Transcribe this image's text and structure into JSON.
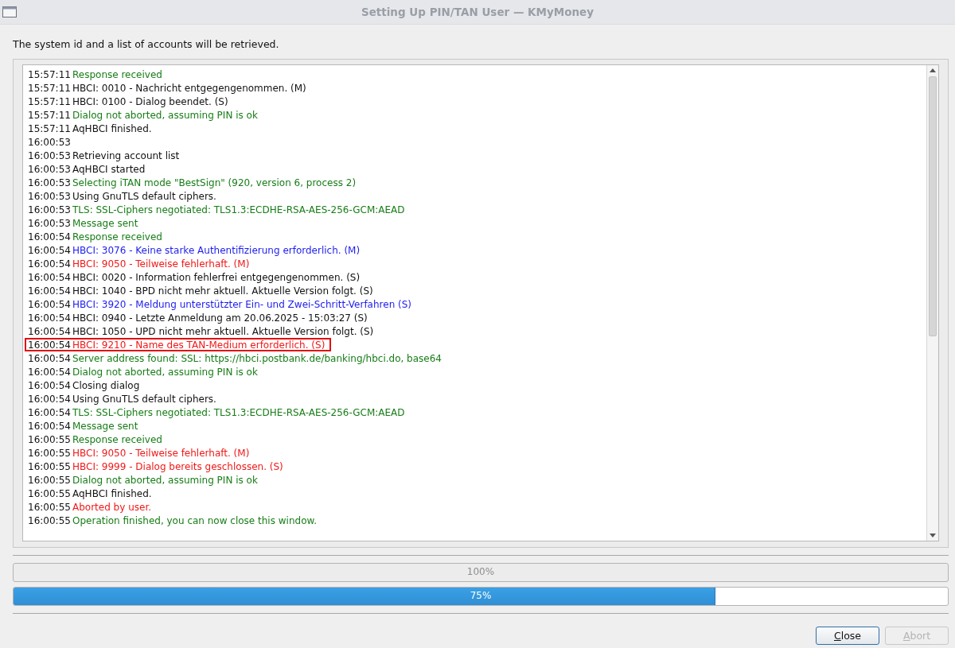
{
  "window": {
    "title": "Setting Up PIN/TAN User — KMyMoney"
  },
  "intro": "The system id and a list of accounts will be retrieved.",
  "log": [
    {
      "time": "15:57:11",
      "text": "Response received",
      "kind": "success",
      "highlighted": false
    },
    {
      "time": "15:57:11",
      "text": "HBCI: 0010 - Nachricht entgegengenommen. (M)",
      "kind": "normal",
      "highlighted": false
    },
    {
      "time": "15:57:11",
      "text": "HBCI: 0100 - Dialog beendet. (S)",
      "kind": "normal",
      "highlighted": false
    },
    {
      "time": "15:57:11",
      "text": "Dialog not aborted, assuming PIN is ok",
      "kind": "success",
      "highlighted": false
    },
    {
      "time": "15:57:11",
      "text": "AqHBCI finished.",
      "kind": "normal",
      "highlighted": false
    },
    {
      "time": "16:00:53",
      "highlighted": false
    },
    {
      "time": "16:00:53",
      "text": "Retrieving account list",
      "kind": "normal",
      "highlighted": false
    },
    {
      "time": "16:00:53",
      "text": "AqHBCI started",
      "kind": "normal",
      "highlighted": false
    },
    {
      "time": "16:00:53",
      "text": "Selecting iTAN mode \"BestSign\" (920, version 6, process 2)",
      "kind": "success",
      "highlighted": false
    },
    {
      "time": "16:00:53",
      "text": "Using GnuTLS default ciphers.",
      "kind": "normal",
      "highlighted": false
    },
    {
      "time": "16:00:53",
      "text": "TLS: SSL-Ciphers negotiated: TLS1.3:ECDHE-RSA-AES-256-GCM:AEAD",
      "kind": "success",
      "highlighted": false
    },
    {
      "time": "16:00:53",
      "text": "Message sent",
      "kind": "success",
      "highlighted": false
    },
    {
      "time": "16:00:54",
      "text": "Response received",
      "kind": "success",
      "highlighted": false
    },
    {
      "time": "16:00:54",
      "text": "HBCI: 3076 - Keine starke Authentifizierung erforderlich. (M)",
      "kind": "info",
      "highlighted": false
    },
    {
      "time": "16:00:54",
      "text": "HBCI: 9050 - Teilweise fehlerhaft. (M)",
      "kind": "error",
      "highlighted": false
    },
    {
      "time": "16:00:54",
      "text": "HBCI: 0020 - Information fehlerfrei entgegengenommen. (S)",
      "kind": "normal",
      "highlighted": false
    },
    {
      "time": "16:00:54",
      "text": "HBCI: 1040 - BPD nicht mehr aktuell. Aktuelle Version folgt. (S)",
      "kind": "normal",
      "highlighted": false
    },
    {
      "time": "16:00:54",
      "text": "HBCI: 3920 - Meldung unterstützter Ein- und Zwei-Schritt-Verfahren (S)",
      "kind": "info",
      "highlighted": false
    },
    {
      "time": "16:00:54",
      "text": "HBCI: 0940 - Letzte Anmeldung am 20.06.2025 - 15:03:27 (S)",
      "kind": "normal",
      "highlighted": false
    },
    {
      "time": "16:00:54",
      "text": "HBCI: 1050 - UPD nicht mehr aktuell. Aktuelle Version folgt. (S)",
      "kind": "normal",
      "highlighted": false
    },
    {
      "time": "16:00:54",
      "text": "HBCI: 9210 - Name des TAN-Medium erforderlich. (S)",
      "kind": "error",
      "highlighted": true
    },
    {
      "time": "16:00:54",
      "text": "Server address found: SSL: https://hbci.postbank.de/banking/hbci.do, base64",
      "kind": "success",
      "highlighted": false
    },
    {
      "time": "16:00:54",
      "text": "Dialog not aborted, assuming PIN is ok",
      "kind": "success",
      "highlighted": false
    },
    {
      "time": "16:00:54",
      "text": "Closing dialog",
      "kind": "normal",
      "highlighted": false
    },
    {
      "time": "16:00:54",
      "text": "Using GnuTLS default ciphers.",
      "kind": "normal",
      "highlighted": false
    },
    {
      "time": "16:00:54",
      "text": "TLS: SSL-Ciphers negotiated: TLS1.3:ECDHE-RSA-AES-256-GCM:AEAD",
      "kind": "success",
      "highlighted": false
    },
    {
      "time": "16:00:54",
      "text": "Message sent",
      "kind": "success",
      "highlighted": false
    },
    {
      "time": "16:00:55",
      "text": "Response received",
      "kind": "success",
      "highlighted": false
    },
    {
      "time": "16:00:55",
      "text": "HBCI: 9050 - Teilweise fehlerhaft. (M)",
      "kind": "error",
      "highlighted": false
    },
    {
      "time": "16:00:55",
      "text": "HBCI: 9999 - Dialog bereits geschlossen. (S)",
      "kind": "error",
      "highlighted": false
    },
    {
      "time": "16:00:55",
      "text": "Dialog not aborted, assuming PIN is ok",
      "kind": "success",
      "highlighted": false
    },
    {
      "time": "16:00:55",
      "text": "AqHBCI finished.",
      "kind": "normal",
      "highlighted": false
    },
    {
      "time": "16:00:55",
      "text": "Aborted by user.",
      "kind": "error",
      "highlighted": false
    },
    {
      "time": "16:00:55",
      "text": "Operation finished, you can now close this window.",
      "kind": "success",
      "highlighted": false
    }
  ],
  "progress": [
    {
      "reading": "100%",
      "disabled": true
    },
    {
      "reading": "75%",
      "level": 0.75,
      "disabled": false
    }
  ],
  "buttons": [
    {
      "label": "Close",
      "disabled": false
    },
    {
      "label": "Abort",
      "disabled": true
    }
  ]
}
